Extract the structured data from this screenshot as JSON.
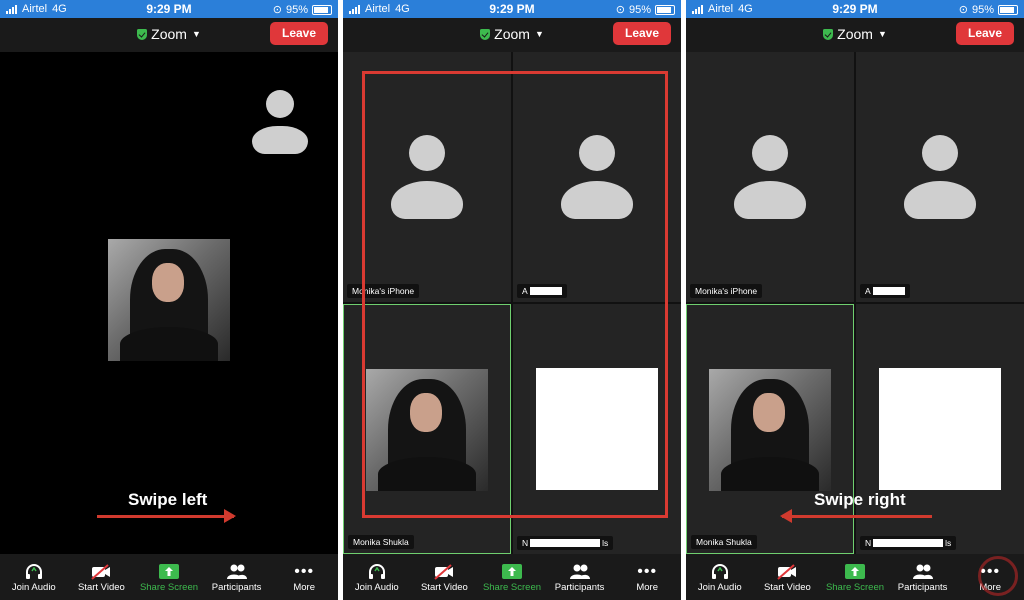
{
  "status": {
    "carrier": "Airtel",
    "network": "4G",
    "time": "9:29 PM",
    "battery": "95%"
  },
  "header": {
    "title": "Zoom",
    "leave_label": "Leave"
  },
  "toolbar": {
    "join_audio": "Join Audio",
    "start_video": "Start Video",
    "share_screen": "Share Screen",
    "participants": "Participants",
    "more": "More"
  },
  "participants": {
    "p1": "Monika's iPhone",
    "p2": "A",
    "p3": "Monika Shukla",
    "p4_prefix": "N",
    "p4_suffix": "ls"
  },
  "annotations": {
    "swipe_left": "Swipe left",
    "swipe_right": "Swipe right"
  },
  "colors": {
    "accent_blue": "#2b7fd9",
    "leave_red": "#e0373a",
    "share_green": "#3dba4e",
    "arrow_red": "#d03a2e",
    "highlight_red": "#d93a32"
  },
  "icons": [
    "headphones-icon",
    "video-off-icon",
    "share-screen-icon",
    "participants-icon",
    "more-icon",
    "shield-icon",
    "chevron-down-icon"
  ]
}
